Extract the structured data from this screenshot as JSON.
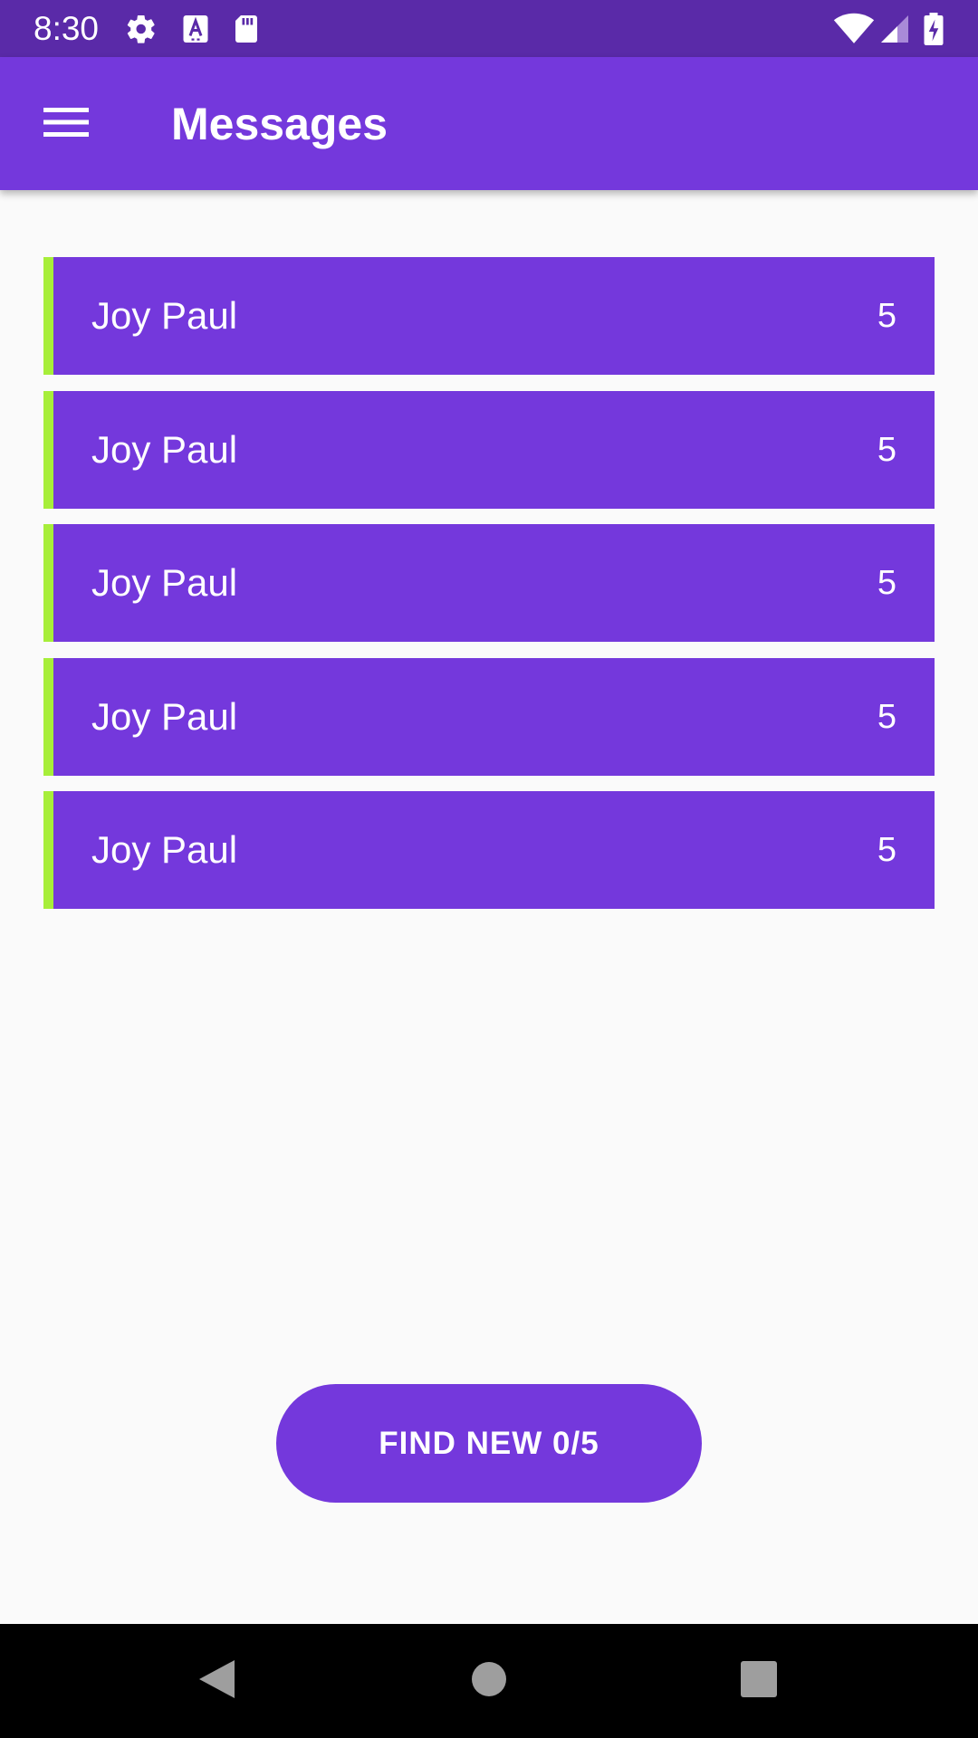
{
  "status_bar": {
    "time": "8:30",
    "left_icons": [
      "gear-icon",
      "font-a-icon",
      "sd-card-icon"
    ],
    "right_icons": [
      "wifi-icon",
      "cell-signal-icon",
      "battery-charging-icon"
    ]
  },
  "app_bar": {
    "title": "Messages",
    "menu_icon": "hamburger-menu-icon"
  },
  "messages": [
    {
      "name": "Joy Paul",
      "count": "5"
    },
    {
      "name": "Joy Paul",
      "count": "5"
    },
    {
      "name": "Joy Paul",
      "count": "5"
    },
    {
      "name": "Joy Paul",
      "count": "5"
    },
    {
      "name": "Joy Paul",
      "count": "5"
    }
  ],
  "find_button": {
    "label": "FIND NEW 0/5"
  },
  "nav_bar": {
    "buttons": [
      "back-icon",
      "home-icon",
      "recents-icon"
    ]
  },
  "colors": {
    "status_bar": "#5a2aa8",
    "primary": "#7438dc",
    "accent": "#a7ee3a",
    "background": "#fafafa",
    "nav_bar": "#000000"
  }
}
